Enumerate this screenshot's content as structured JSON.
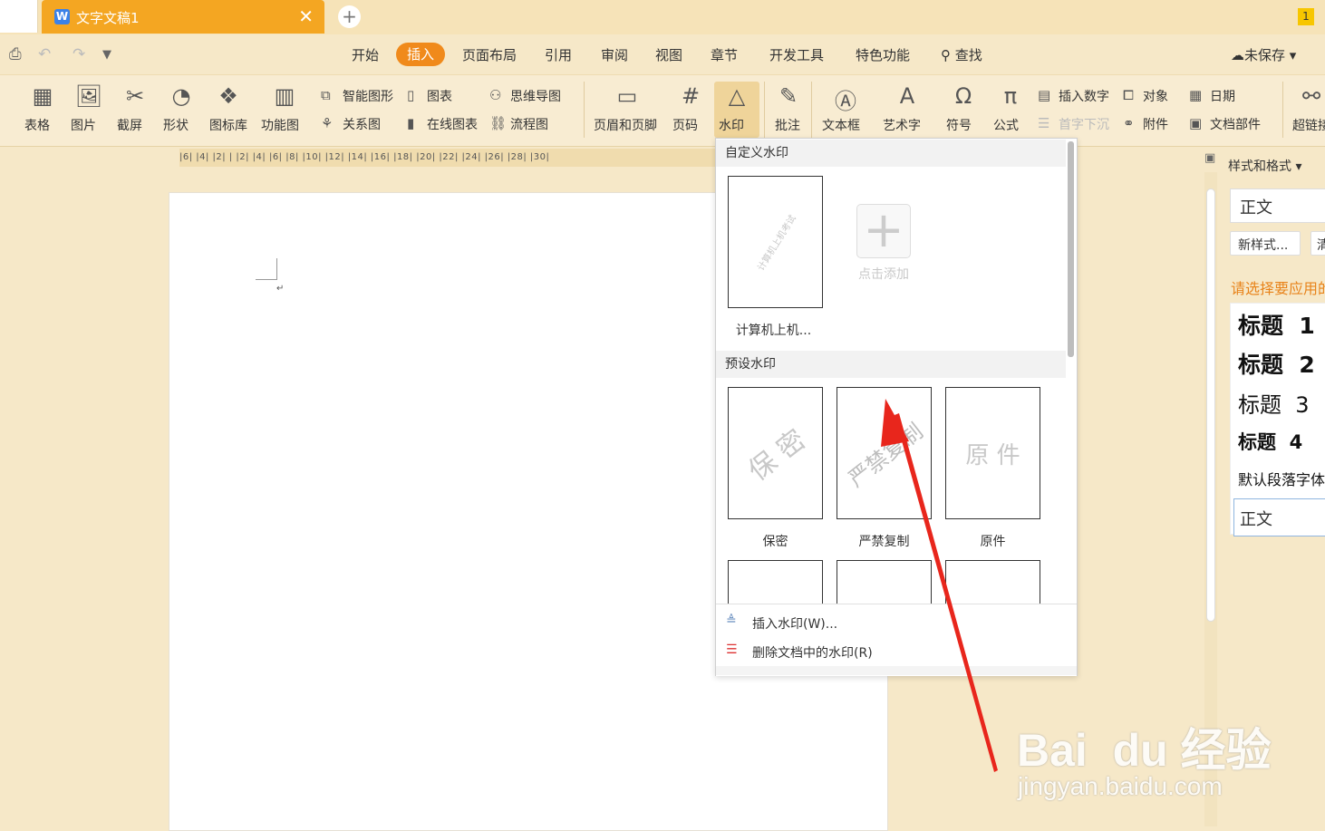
{
  "titlebar": {
    "doc_title": "文字文稿1",
    "close": "✕",
    "new_tab": "+",
    "badge": "1"
  },
  "menu": {
    "items": [
      "开始",
      "页面布局",
      "引用",
      "审阅",
      "视图",
      "章节",
      "开发工具",
      "特色功能",
      "查找"
    ],
    "active": "插入",
    "save_status": "未保存"
  },
  "ribbon": {
    "big": [
      "表格",
      "图片",
      "截屏",
      "形状",
      "图标库",
      "功能图"
    ],
    "small_col1": [
      "智能图形",
      "关系图"
    ],
    "small_col2": [
      "图表",
      "在线图表"
    ],
    "small_col3": [
      "思维导图",
      "流程图"
    ],
    "big2": [
      "页眉和页脚",
      "页码",
      "水印",
      "批注",
      "文本框",
      "艺术字",
      "符号",
      "公式"
    ],
    "small_col4": [
      "插入数字",
      "首字下沉"
    ],
    "small_col5": [
      "对象",
      "附件"
    ],
    "small_col6": [
      "日期",
      "文档部件"
    ],
    "last": "超链接"
  },
  "ruler": {
    "labels": "|6| |4| |2| | |2| |4| |6| |8| |10| |12| |14| |16| |18| |20| |22| |24| |26| |28| |30|"
  },
  "dropdown": {
    "custom_header": "自定义水印",
    "custom_thumb_text": "计算机上机考试",
    "custom_label": "计算机上机...",
    "add_label": "点击添加",
    "preset_header": "预设水印",
    "presets": [
      {
        "wm": "保 密",
        "label": "保密"
      },
      {
        "wm": "严禁复制",
        "label": "严禁复制"
      },
      {
        "wm": "原 件",
        "label": "原件"
      }
    ],
    "insert": "插入水印(W)...",
    "delete": "删除文档中的水印(R)"
  },
  "rpanel": {
    "title": "样式和格式",
    "current": "正文",
    "new_style": "新样式...",
    "clear": "清",
    "prompt": "请选择要应用的格式",
    "headings": [
      "标题  1",
      "标题  2",
      "标题  3",
      "标题  4"
    ],
    "default_font": "默认段落字体",
    "body": "正文"
  },
  "watermark": {
    "brand": "Bai  du 经验",
    "url": "jingyan.baidu.com"
  },
  "colors": {
    "accent": "#f08a1b",
    "tab": "#f4a622",
    "arrow": "#e8261c"
  }
}
